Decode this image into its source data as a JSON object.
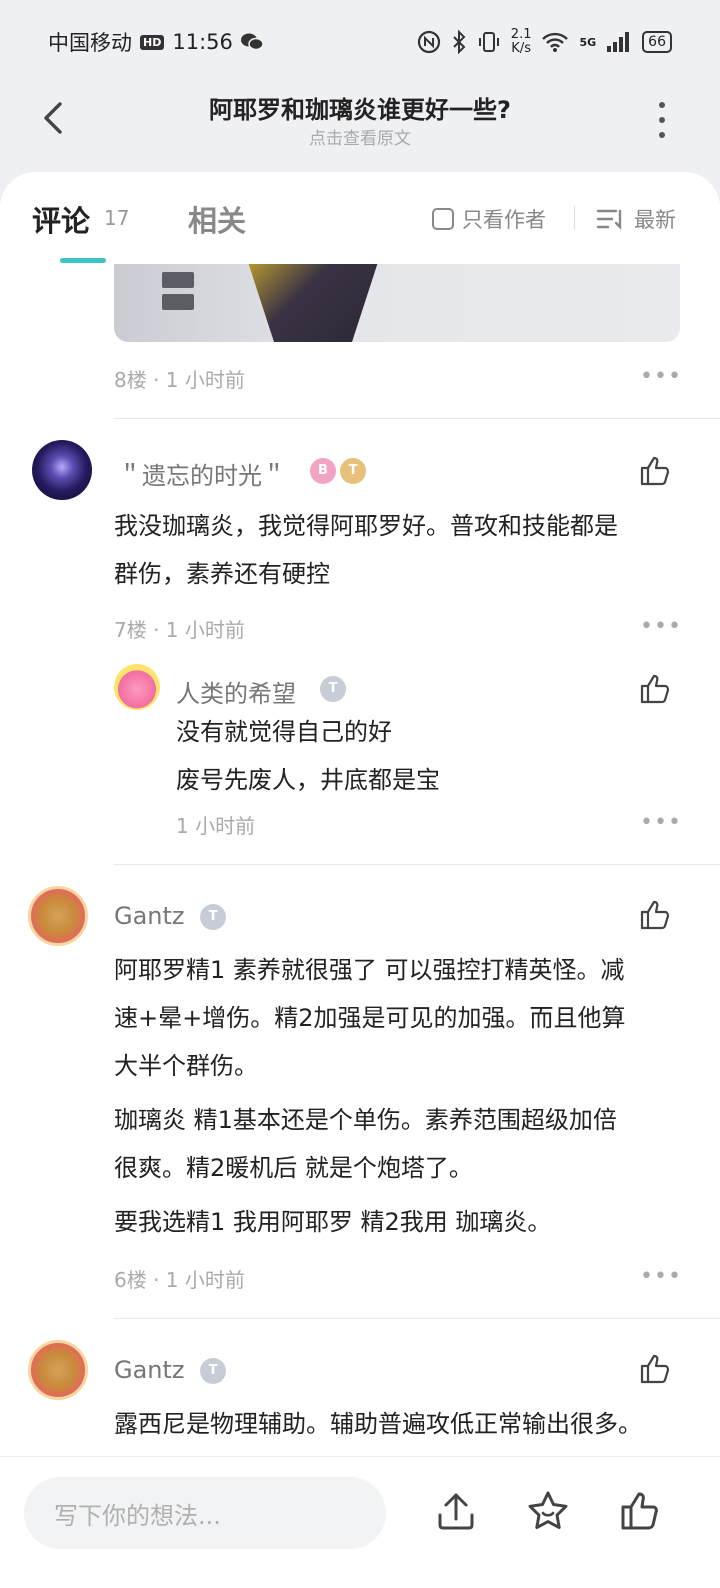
{
  "status_bar": {
    "carrier": "中国移动",
    "hd": "HD",
    "time": "11:56",
    "net_speed_value": "2.1",
    "net_speed_unit": "K/s",
    "signal_label": "5G",
    "battery": "66"
  },
  "header": {
    "title": "阿耶罗和珈璃炎谁更好一些?",
    "subtitle": "点击查看原文"
  },
  "tabs": {
    "comments_label": "评论",
    "comments_count": "17",
    "related_label": "相关",
    "author_only_label": "只看作者",
    "sort_label": "最新"
  },
  "posts": {
    "floor8": {
      "meta": "8楼 · 1 小时前"
    },
    "floor7": {
      "username": "＂遗忘的时光＂",
      "badge1": "B",
      "badge2": "T",
      "line1": "我没珈璃炎，我觉得阿耶罗好。普攻和技能都是",
      "line2": "群伤，素养还有硬控",
      "meta": "7楼 · 1 小时前",
      "reply": {
        "username": "人类的希望",
        "badge": "T",
        "line1": "没有就觉得自己的好",
        "line2": "废号先废人，井底都是宝",
        "meta": "1 小时前"
      }
    },
    "floor6": {
      "username": "Gantz",
      "badge": "T",
      "line1": "阿耶罗精1 素养就很强了 可以强控打精英怪。减",
      "line2": "速+晕+增伤。精2加强是可见的加强。而且他算",
      "line3": "大半个群伤。",
      "line4": "珈璃炎 精1基本还是个单伤。素养范围超级加倍",
      "line5": "很爽。精2暖机后 就是个炮塔了。",
      "line6": "要我选精1 我用阿耶罗  精2我用 珈璃炎。",
      "meta": "6楼 · 1 小时前"
    },
    "floor5": {
      "username": "Gantz",
      "badge": "T",
      "line1": "露西尼是物理辅助。辅助普遍攻低正常输出很多。"
    }
  },
  "more_dots": "•••",
  "bottom_bar": {
    "input_placeholder": "写下你的想法..."
  }
}
